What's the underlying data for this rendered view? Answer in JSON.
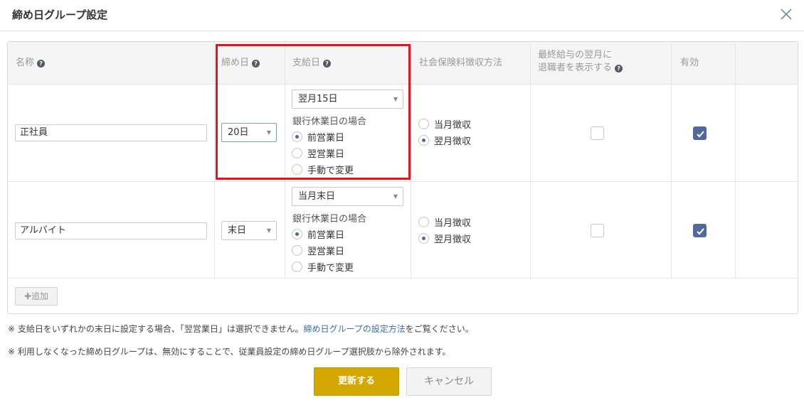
{
  "dialog": {
    "title": "締め日グループ設定",
    "close_icon": "close-icon"
  },
  "table": {
    "headers": {
      "name": "名称",
      "closing_day": "締め日",
      "pay_day": "支給日",
      "insurance_method": "社会保険料徴収方法",
      "show_retired_line1": "最終給与の翌月に",
      "show_retired_line2": "退職者を表示する",
      "enabled": "有効"
    },
    "rows": [
      {
        "name": "正社員",
        "closing_day": "20日",
        "pay_day": "翌月15日",
        "holiday_label": "銀行休業日の場合",
        "holiday_options": [
          "前営業日",
          "翌営業日",
          "手動で変更"
        ],
        "holiday_selected": 0,
        "insurance_options": [
          "当月徴収",
          "翌月徴収"
        ],
        "insurance_selected": 1,
        "show_retired": false,
        "enabled": true
      },
      {
        "name": "アルバイト",
        "closing_day": "末日",
        "pay_day": "当月末日",
        "holiday_label": "銀行休業日の場合",
        "holiday_options": [
          "前営業日",
          "翌営業日",
          "手動で変更"
        ],
        "holiday_selected": 0,
        "insurance_options": [
          "当月徴収",
          "翌月徴収"
        ],
        "insurance_selected": 1,
        "show_retired": false,
        "enabled": true
      }
    ],
    "add_button": "追加"
  },
  "notes": {
    "note1_prefix": "※ 支給日をいずれかの末日に設定する場合、「翌営業日」は選択できません。",
    "note1_link": "締め日グループの設定方法",
    "note1_suffix": "をご覧ください。",
    "note2": "※ 利用しなくなった締め日グループは、無効にすることで、従業員設定の締め日グループ選択肢から除外されます。"
  },
  "actions": {
    "update": "更新する",
    "cancel": "キャンセル"
  },
  "colors": {
    "accent": "#4f6a9a",
    "primary_button": "#d4a800",
    "highlight": "#e8141c",
    "link": "#3a6fa8"
  }
}
